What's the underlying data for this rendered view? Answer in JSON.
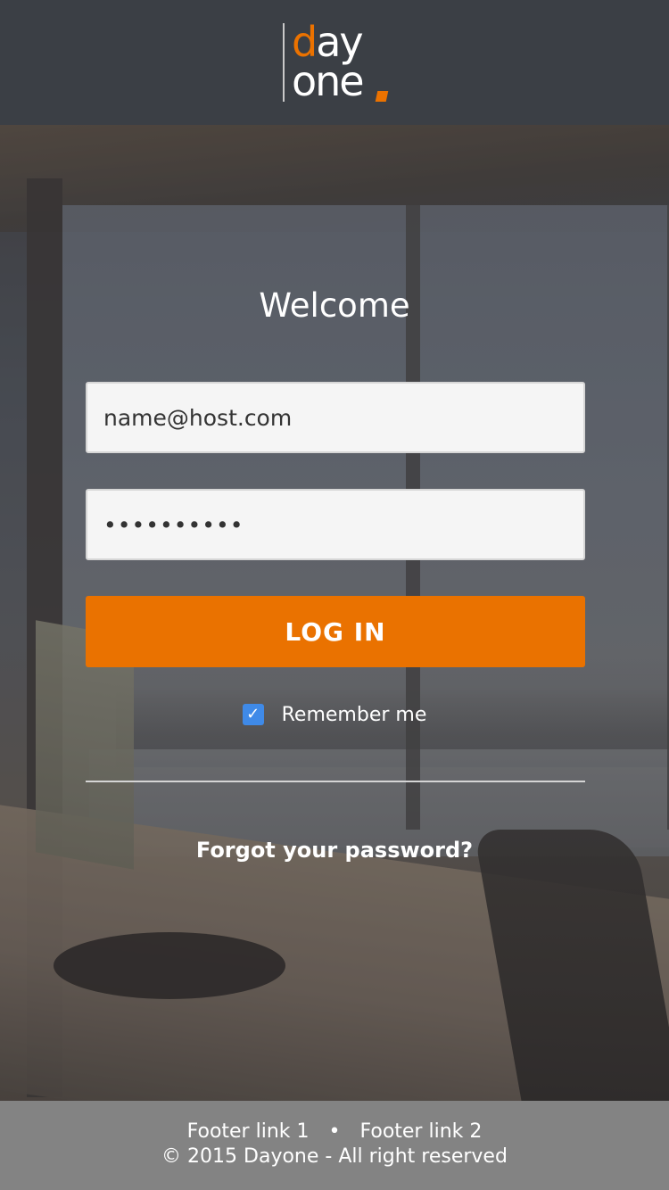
{
  "header": {
    "logo": {
      "line1_orange": "d",
      "line1_rest": "ay",
      "line2": "one",
      "accent_color": "#eb7200"
    }
  },
  "login": {
    "welcome": "Welcome",
    "email_value": "name@host.com",
    "password_value": "••••••••••",
    "login_button": "LOG IN",
    "remember_checked": true,
    "remember_label": "Remember me",
    "forgot_link": "Forgot your password?"
  },
  "footer": {
    "link1": "Footer link 1",
    "separator": "•",
    "link2": "Footer link 2",
    "copyright": "© 2015 Dayone - All right reserved"
  },
  "colors": {
    "primary": "#ea7200",
    "header_bg": "#3b3f45",
    "footer_bg": "#838383",
    "checkbox": "#3f8ae8"
  }
}
